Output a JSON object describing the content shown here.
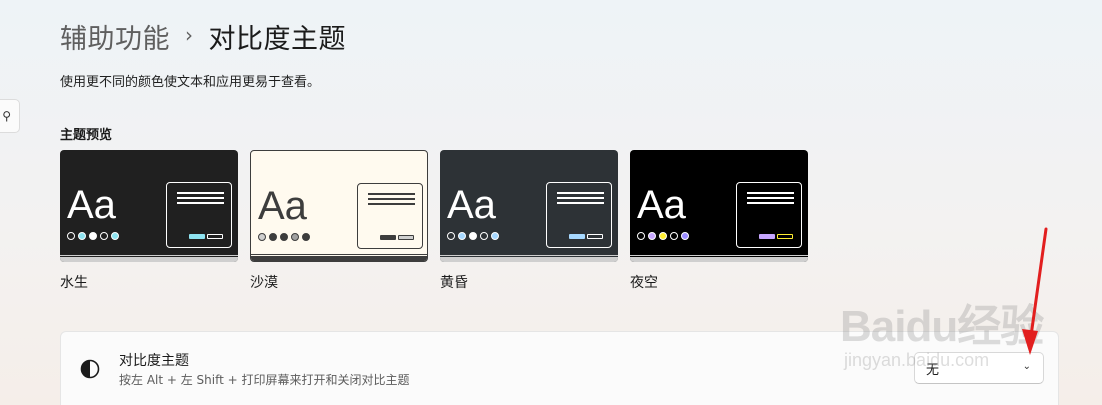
{
  "breadcrumb": {
    "parent": "辅助功能",
    "separator": "›",
    "current": "对比度主题"
  },
  "description": "使用更不同的颜色使文本和应用更易于查看。",
  "preview_section": {
    "title": "主题预览"
  },
  "themes": [
    {
      "name": "水生",
      "sample_text": "Aa",
      "colors": {
        "bg": "#202020",
        "text": "#ffffff",
        "window_border": "#ffffff",
        "line": "#ffffff",
        "dots": [
          "#202020",
          "#8ee3f0",
          "#ffffff",
          "#202020",
          "#8ee3f0"
        ],
        "dot_border": "#ffffff",
        "btn1": "#8ee3f0",
        "btn2": "#202020",
        "btn2_border": "#ffffff",
        "bottom": "#cfcfcf"
      }
    },
    {
      "name": "沙漠",
      "sample_text": "Aa",
      "colors": {
        "bg": "#fffaef",
        "text": "#3d3d3d",
        "window_border": "#3d3d3d",
        "line": "#3d3d3d",
        "dots": [
          "#cfcfcf",
          "#3d3d3d",
          "#3d3d3d",
          "#a0a0a0",
          "#3d3d3d"
        ],
        "dot_border": "#3d3d3d",
        "btn1": "#3d3d3d",
        "btn2": "#d0d0d0",
        "btn2_border": "#3d3d3d",
        "bottom": "#3d3d3d"
      }
    },
    {
      "name": "黄昏",
      "sample_text": "Aa",
      "colors": {
        "bg": "#2d3236",
        "text": "#ffffff",
        "window_border": "#ffffff",
        "line": "#ffffff",
        "dots": [
          "#2d3236",
          "#a6d8ff",
          "#ffffff",
          "#2d3236",
          "#a6d8ff"
        ],
        "dot_border": "#ffffff",
        "btn1": "#a6d8ff",
        "btn2": "#2d3236",
        "btn2_border": "#ffffff",
        "bottom": "#cfcfcf"
      }
    },
    {
      "name": "夜空",
      "sample_text": "Aa",
      "colors": {
        "bg": "#000000",
        "text": "#ffffff",
        "window_border": "#ffffff",
        "line": "#ffffff",
        "dots": [
          "#000000",
          "#c6a6ff",
          "#ffee32",
          "#000000",
          "#9a8cff"
        ],
        "dot_border": "#ffffff",
        "btn1": "#c6a6ff",
        "btn2": "#000000",
        "btn2_border": "#ffee32",
        "bottom": "#cfcfcf"
      }
    }
  ],
  "contrast_setting": {
    "title": "对比度主题",
    "subtitle": "按左 Alt + 左 Shift + 打印屏幕来打开和关闭对比主题",
    "icon": "contrast-icon",
    "dropdown_value": "无",
    "dropdown_icon": "chevron-down-icon"
  },
  "watermark": {
    "logo": "Baidu经验",
    "url": "jingyan.baidu.com"
  },
  "sidebar": {
    "search_icon": "search-icon"
  }
}
